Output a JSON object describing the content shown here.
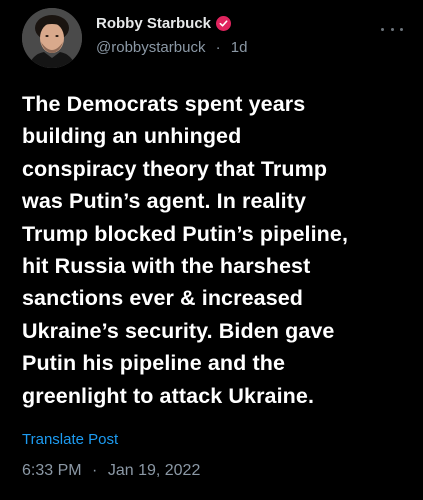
{
  "author": {
    "name": "Robby Starbuck",
    "handle": "@robbystarbuck",
    "time_ago": "1d",
    "separator": "·",
    "avatar_icon": "profile-photo",
    "badge_icon": "verified-check-icon",
    "badge_color": "#e0245e"
  },
  "post": {
    "text": "The Democrats spent years\nbuilding an unhinged\nconspiracy theory that Trump\nwas Putin’s agent. In reality\nTrump blocked Putin’s pipeline,\nhit Russia with the harshest\nsanctions ever & increased\nUkraine’s security. Biden gave\nPutin his pipeline and the\ngreenlight to attack Ukraine."
  },
  "actions": {
    "translate_label": "Translate Post",
    "more_icon": "more-dots-icon"
  },
  "timestamp": {
    "time": "6:33 PM",
    "separator": "·",
    "date": "Jan 19, 2022"
  },
  "colors": {
    "background": "#000000",
    "text_primary": "#ffffff",
    "text_secondary": "#8b98a5",
    "link": "#1d9bf0"
  }
}
